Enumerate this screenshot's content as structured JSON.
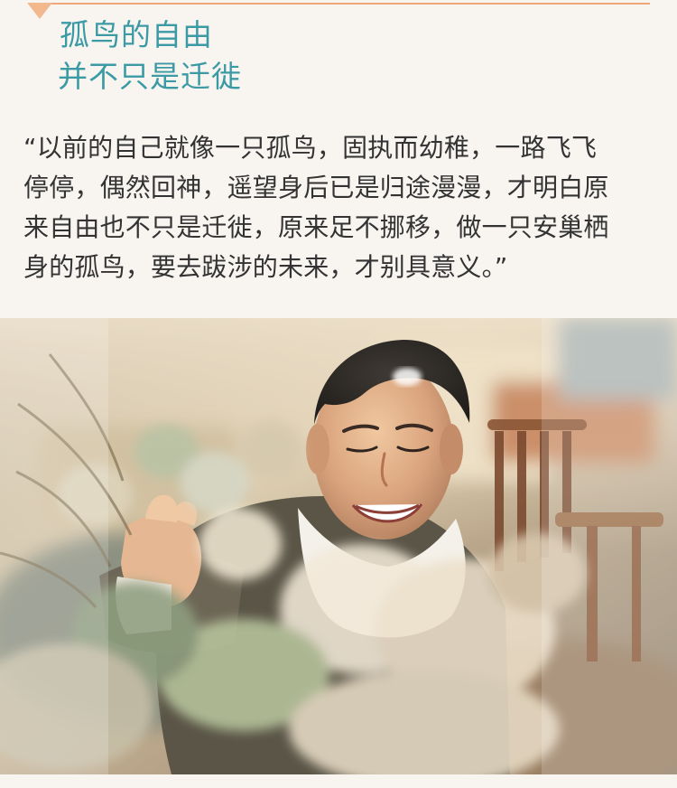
{
  "article": {
    "heading": {
      "line1": "孤鸟的自由",
      "line2": "并不只是迁徙"
    },
    "quote": "“以前的自己就像一只孤鸟，固执而幼稚，一路飞飞\n停停，偶然回神，遥望身后已是归途漫漫，才明白原\n来自由也不只是迁徙，原来足不挪移，做一只安巢栖\n身的孤鸟，要去跋涉的未来，才别具意义。”"
  },
  "photo": {
    "alt": ""
  },
  "colors": {
    "heading": "#3b9aa3",
    "accent": "#efa77a",
    "background": "#f8f5f1",
    "body_text": "#333333"
  }
}
